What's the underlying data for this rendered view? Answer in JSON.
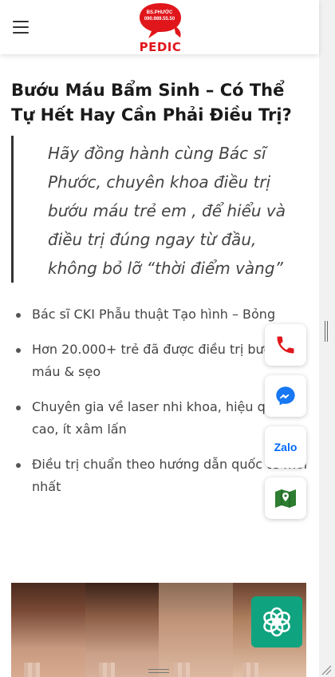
{
  "header": {
    "logo": {
      "bubble_text": "BS.PHƯỚC\n090.989.55.50",
      "name": "PEDIC",
      "brand_color": "#e0161b"
    },
    "menu_icon": "hamburger-icon"
  },
  "article": {
    "title": "Bướu Máu Bẩm Sinh – Có Thể Tự Hết Hay Cần Phải Điều Trị?",
    "quote": "Hãy đồng hành cùng Bác sĩ Phước, chuyên khoa điều trị bướu máu trẻ em , để hiểu và điều trị đúng ngay từ đầu, không bỏ lỡ “thời điểm vàng”",
    "bullets": [
      "Bác sĩ CKI Phẫu thuật Tạo hình – Bỏng",
      "Hơn 20.000+ trẻ đã được điều trị bướu máu & sẹo",
      "Chuyên gia về laser nhi khoa, hiệu quả cao, ít xâm lấn",
      "Điều trị chuẩn theo hướng dẫn quốc tế mới nhất"
    ]
  },
  "floating_actions": {
    "phone_icon": "phone-icon",
    "messenger_icon": "messenger-icon",
    "zalo_label": "Zalo",
    "map_icon": "map-icon",
    "chat_icon": "chatgpt-icon",
    "phone_color": "#e0161b",
    "messenger_color": "#1877f2",
    "zalo_color": "#0068ff",
    "map_color": "#2e7d32",
    "chat_color": "#10a37f"
  }
}
